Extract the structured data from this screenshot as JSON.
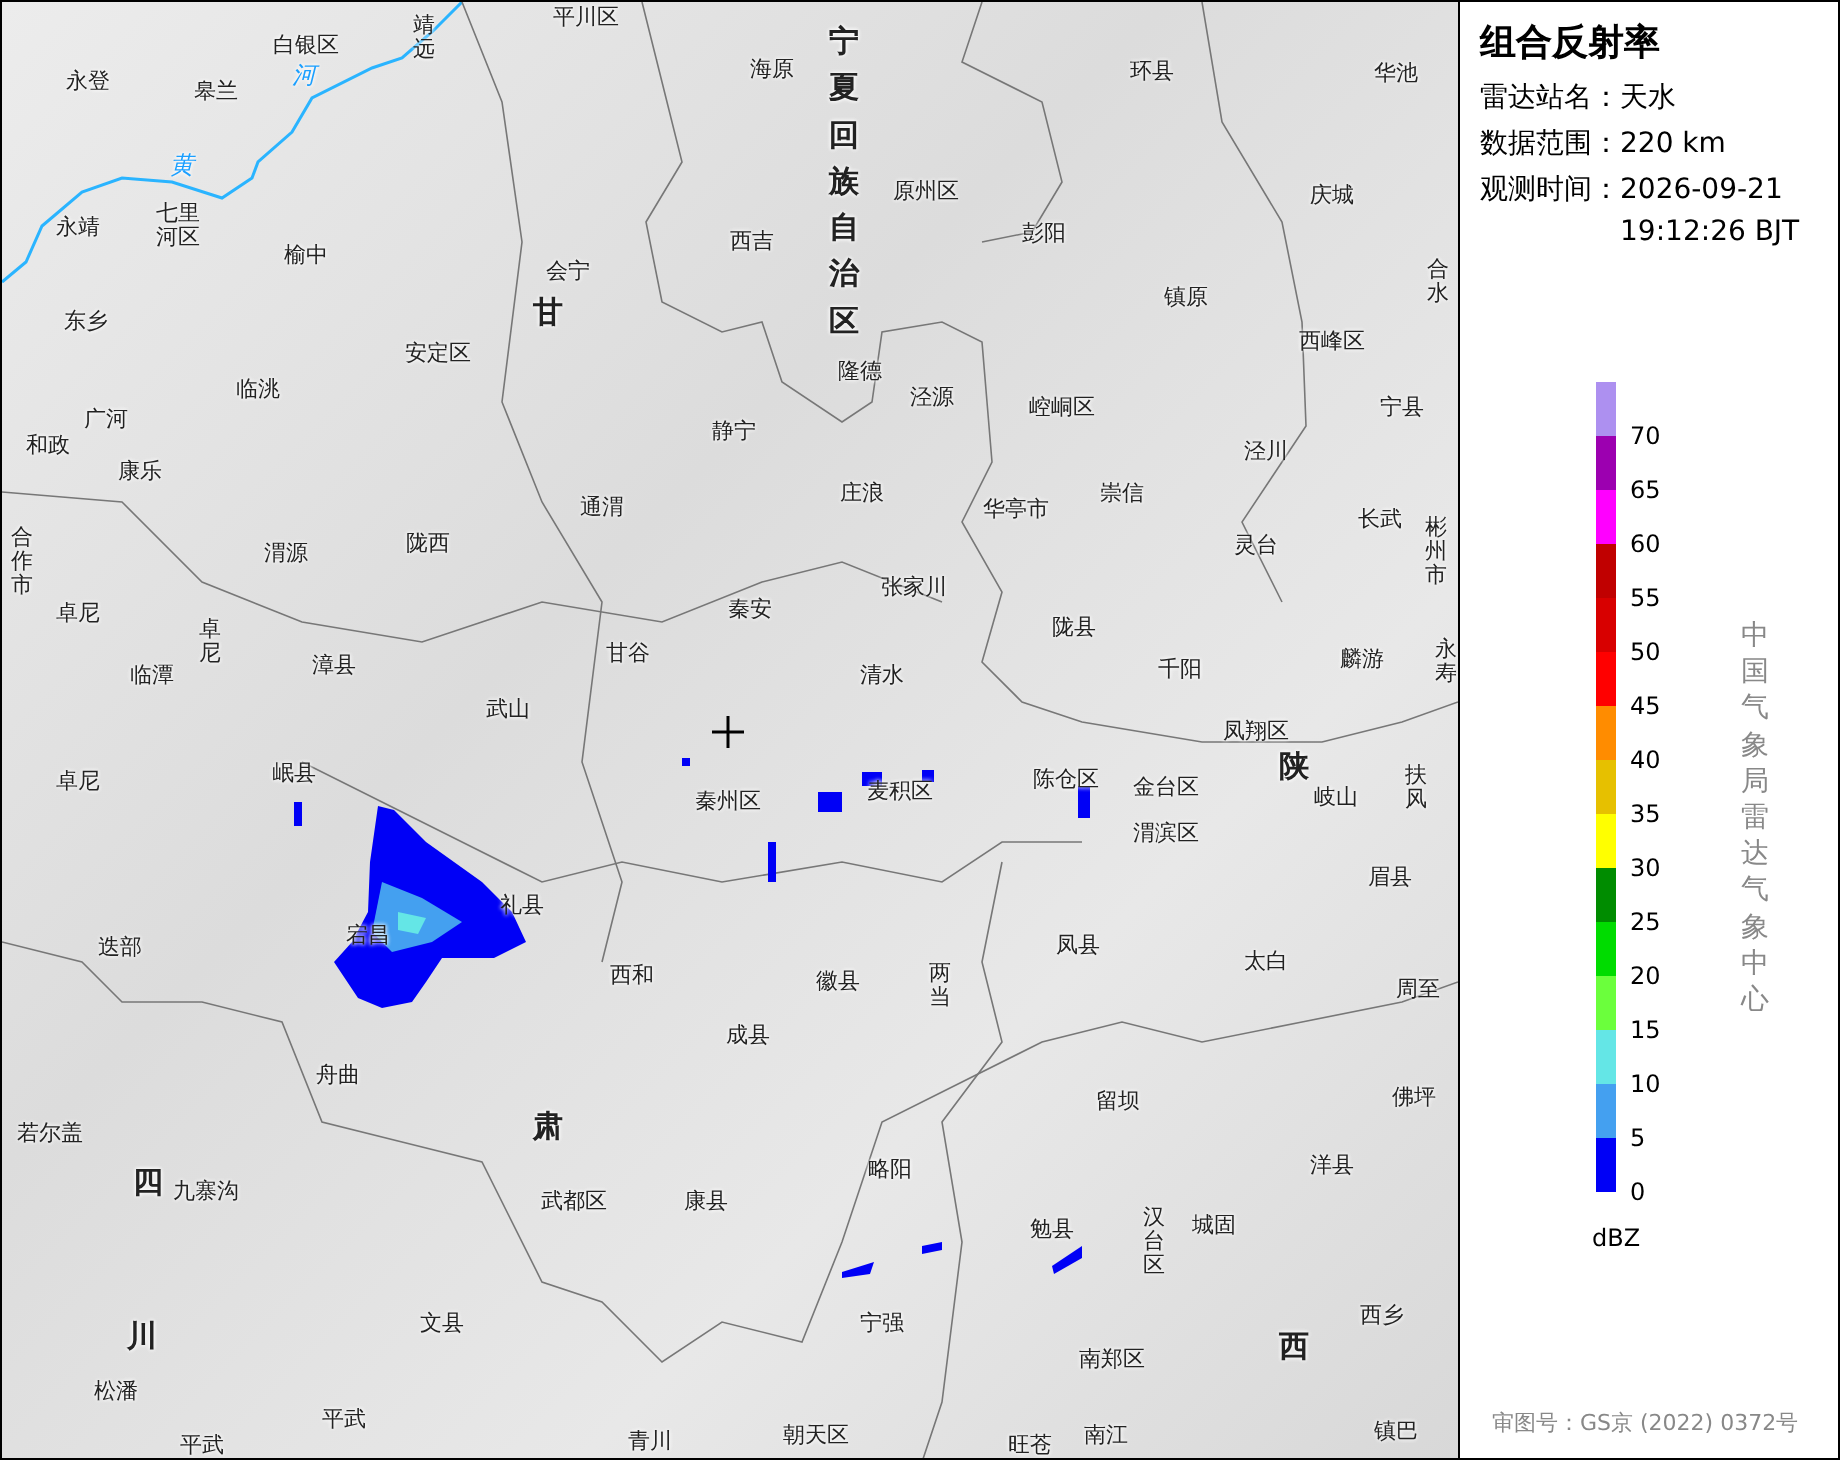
{
  "panel": {
    "title": "组合反射率",
    "fields": [
      {
        "label": "雷达站名：",
        "value": "天水"
      },
      {
        "label": "数据范围：",
        "value": "220 km"
      },
      {
        "label": "观测时间：",
        "value": "2026-09-21 19:12:26 BJT"
      }
    ]
  },
  "legend": {
    "items": [
      {
        "color": "#ad90f0",
        "label": "70"
      },
      {
        "color": "#9c00b0",
        "label": "65"
      },
      {
        "color": "#ff00ff",
        "label": "60"
      },
      {
        "color": "#c00000",
        "label": "55"
      },
      {
        "color": "#d80000",
        "label": "50"
      },
      {
        "color": "#ff0000",
        "label": "45"
      },
      {
        "color": "#ff8c00",
        "label": "40"
      },
      {
        "color": "#e6c000",
        "label": "35"
      },
      {
        "color": "#ffff00",
        "label": "30"
      },
      {
        "color": "#008c00",
        "label": "25"
      },
      {
        "color": "#00dc00",
        "label": "20"
      },
      {
        "color": "#6bff3c",
        "label": "15"
      },
      {
        "color": "#64e6e6",
        "label": "10"
      },
      {
        "color": "#44a0f0",
        "label": "5"
      },
      {
        "color": "#0000f6",
        "label": "0"
      }
    ],
    "unit": "dBZ"
  },
  "source_note": "中国气象局雷达气象中心",
  "approval_number": "审图号：GS京 (2022) 0372号",
  "map_labels": [
    {
      "name": "白银区",
      "kind": "county"
    },
    {
      "name": "靖远",
      "kind": "county_vertical"
    },
    {
      "name": "平川区",
      "kind": "county"
    },
    {
      "name": "宁夏回族自治区",
      "kind": "province_vertical"
    },
    {
      "name": "永登",
      "kind": "county"
    },
    {
      "name": "皋兰",
      "kind": "county"
    },
    {
      "name": "河",
      "kind": "river"
    },
    {
      "name": "海原",
      "kind": "county"
    },
    {
      "name": "环县",
      "kind": "county"
    },
    {
      "name": "华池",
      "kind": "county"
    },
    {
      "name": "黄",
      "kind": "river"
    },
    {
      "name": "永靖",
      "kind": "county"
    },
    {
      "name": "原州区",
      "kind": "county"
    },
    {
      "name": "庆城",
      "kind": "county"
    },
    {
      "name": "七里河区",
      "kind": "county_wrap"
    },
    {
      "name": "西吉",
      "kind": "county"
    },
    {
      "name": "彭阳",
      "kind": "county"
    },
    {
      "name": "榆中",
      "kind": "county"
    },
    {
      "name": "会宁",
      "kind": "county"
    },
    {
      "name": "合水",
      "kind": "county_vertical"
    },
    {
      "name": "东乡",
      "kind": "county"
    },
    {
      "name": "甘",
      "kind": "province"
    },
    {
      "name": "镇原",
      "kind": "county"
    },
    {
      "name": "安定区",
      "kind": "county"
    },
    {
      "name": "隆德",
      "kind": "county"
    },
    {
      "name": "西峰区",
      "kind": "county"
    },
    {
      "name": "临洮",
      "kind": "county"
    },
    {
      "name": "泾源",
      "kind": "county"
    },
    {
      "name": "崆峒区",
      "kind": "county"
    },
    {
      "name": "宁县",
      "kind": "county"
    },
    {
      "name": "和政",
      "kind": "county"
    },
    {
      "name": "广河",
      "kind": "county"
    },
    {
      "name": "静宁",
      "kind": "county"
    },
    {
      "name": "泾川",
      "kind": "county"
    },
    {
      "name": "康乐",
      "kind": "county"
    },
    {
      "name": "通渭",
      "kind": "county"
    },
    {
      "name": "庄浪",
      "kind": "county"
    },
    {
      "name": "华亭市",
      "kind": "county"
    },
    {
      "name": "崇信",
      "kind": "county"
    },
    {
      "name": "长武",
      "kind": "county"
    },
    {
      "name": "合作市",
      "kind": "county_vertical"
    },
    {
      "name": "渭源",
      "kind": "county"
    },
    {
      "name": "陇西",
      "kind": "county"
    },
    {
      "name": "灵台",
      "kind": "county"
    },
    {
      "name": "彬州市",
      "kind": "county_vertical"
    },
    {
      "name": "秦安",
      "kind": "county"
    },
    {
      "name": "张家川",
      "kind": "county"
    },
    {
      "name": "卓尼",
      "kind": "county"
    },
    {
      "name": "卓尼",
      "kind": "county_vertical"
    },
    {
      "name": "陇县",
      "kind": "county"
    },
    {
      "name": "临潭",
      "kind": "county"
    },
    {
      "name": "漳县",
      "kind": "county"
    },
    {
      "name": "甘谷",
      "kind": "county"
    },
    {
      "name": "清水",
      "kind": "county"
    },
    {
      "name": "千阳",
      "kind": "county"
    },
    {
      "name": "麟游",
      "kind": "county"
    },
    {
      "name": "永寿",
      "kind": "county_vertical"
    },
    {
      "name": "武山",
      "kind": "county"
    },
    {
      "name": "凤翔区",
      "kind": "county"
    },
    {
      "name": "陕",
      "kind": "province"
    },
    {
      "name": "卓尼",
      "kind": "county"
    },
    {
      "name": "岷县",
      "kind": "county"
    },
    {
      "name": "秦州区",
      "kind": "county"
    },
    {
      "name": "麦积区",
      "kind": "county"
    },
    {
      "name": "陈仓区",
      "kind": "county"
    },
    {
      "name": "金台区",
      "kind": "county"
    },
    {
      "name": "岐山",
      "kind": "county"
    },
    {
      "name": "扶风",
      "kind": "county_vertical"
    },
    {
      "name": "渭滨区",
      "kind": "county"
    },
    {
      "name": "眉县",
      "kind": "county"
    },
    {
      "name": "礼县",
      "kind": "county"
    },
    {
      "name": "迭部",
      "kind": "county"
    },
    {
      "name": "宕昌",
      "kind": "county"
    },
    {
      "name": "凤县",
      "kind": "county"
    },
    {
      "name": "太白",
      "kind": "county"
    },
    {
      "name": "西和",
      "kind": "county"
    },
    {
      "name": "徽县",
      "kind": "county"
    },
    {
      "name": "两当",
      "kind": "county_vertical"
    },
    {
      "name": "周至",
      "kind": "county"
    },
    {
      "name": "成县",
      "kind": "county"
    },
    {
      "name": "舟曲",
      "kind": "county"
    },
    {
      "name": "肃",
      "kind": "province"
    },
    {
      "name": "留坝",
      "kind": "county"
    },
    {
      "name": "佛坪",
      "kind": "county"
    },
    {
      "name": "若尔盖",
      "kind": "county"
    },
    {
      "name": "略阳",
      "kind": "county"
    },
    {
      "name": "洋县",
      "kind": "county"
    },
    {
      "name": "四",
      "kind": "province"
    },
    {
      "name": "九寨沟",
      "kind": "county"
    },
    {
      "name": "武都区",
      "kind": "county"
    },
    {
      "name": "康县",
      "kind": "county"
    },
    {
      "name": "勉县",
      "kind": "county"
    },
    {
      "name": "汉台区",
      "kind": "county_vertical"
    },
    {
      "name": "城固",
      "kind": "county"
    },
    {
      "name": "川",
      "kind": "province"
    },
    {
      "name": "文县",
      "kind": "county"
    },
    {
      "name": "宁强",
      "kind": "county"
    },
    {
      "name": "西乡",
      "kind": "county"
    },
    {
      "name": "南郑区",
      "kind": "county"
    },
    {
      "name": "西",
      "kind": "province"
    },
    {
      "name": "松潘",
      "kind": "county"
    },
    {
      "name": "平武",
      "kind": "county"
    },
    {
      "name": "平武",
      "kind": "county"
    },
    {
      "name": "青川",
      "kind": "county"
    },
    {
      "name": "朝天区",
      "kind": "county"
    },
    {
      "name": "旺苍",
      "kind": "county"
    },
    {
      "name": "南江",
      "kind": "county"
    },
    {
      "name": "镇巴",
      "kind": "county"
    }
  ]
}
